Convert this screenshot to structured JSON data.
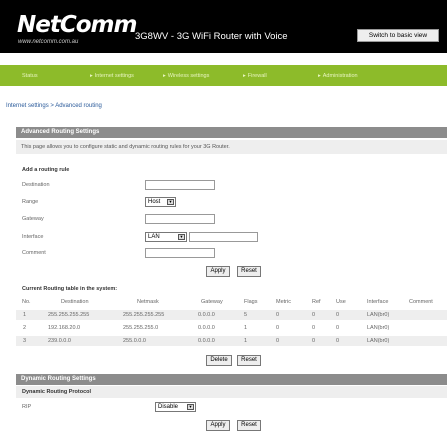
{
  "header": {
    "logo": "NetComm",
    "logo_url": "www.netcomm.com.au",
    "model": "3G8WV - 3G WiFi Router with Voice",
    "switch_label": "Switch to basic view"
  },
  "nav": {
    "items": [
      "Status",
      "Internet settings",
      "Wireless settings",
      "Firewall",
      "Administration"
    ]
  },
  "breadcrumb": "Internet settings > Advanced routing",
  "advanced": {
    "title": "Advanced Routing Settings",
    "description": "This page allows you to configure static and dynamic routing rules for your 3G Router.",
    "add_rule_title": "Add a routing rule",
    "labels": {
      "destination": "Destination",
      "range": "Range",
      "gateway": "Gateway",
      "interface": "Interface",
      "comment": "Comment"
    },
    "range_value": "Host",
    "interface_value": "LAN",
    "apply_label": "Apply",
    "reset_label": "Reset"
  },
  "routing_table": {
    "title": "Current Routing table in the system:",
    "headers": [
      "No.",
      "Destination",
      "Netmask",
      "Gateway",
      "Flags",
      "Metric",
      "Ref",
      "Use",
      "Interface",
      "Comment"
    ],
    "rows": [
      [
        "1",
        "255.255.255.255",
        "255.255.255.255",
        "0.0.0.0",
        "5",
        "0",
        "0",
        "0",
        "LAN(br0)",
        ""
      ],
      [
        "2",
        "192.168.20.0",
        "255.255.255.0",
        "0.0.0.0",
        "1",
        "0",
        "0",
        "0",
        "LAN(br0)",
        ""
      ],
      [
        "3",
        "239.0.0.0",
        "255.0.0.0",
        "0.0.0.0",
        "1",
        "0",
        "0",
        "0",
        "LAN(br0)",
        ""
      ]
    ],
    "delete_label": "Delete",
    "reset_label": "Reset"
  },
  "dynamic": {
    "title": "Dynamic Routing Settings",
    "protocol_title": "Dynamic Routing Protocol",
    "rip_label": "RIP",
    "rip_value": "Disable",
    "apply_label": "Apply",
    "reset_label": "Reset"
  }
}
